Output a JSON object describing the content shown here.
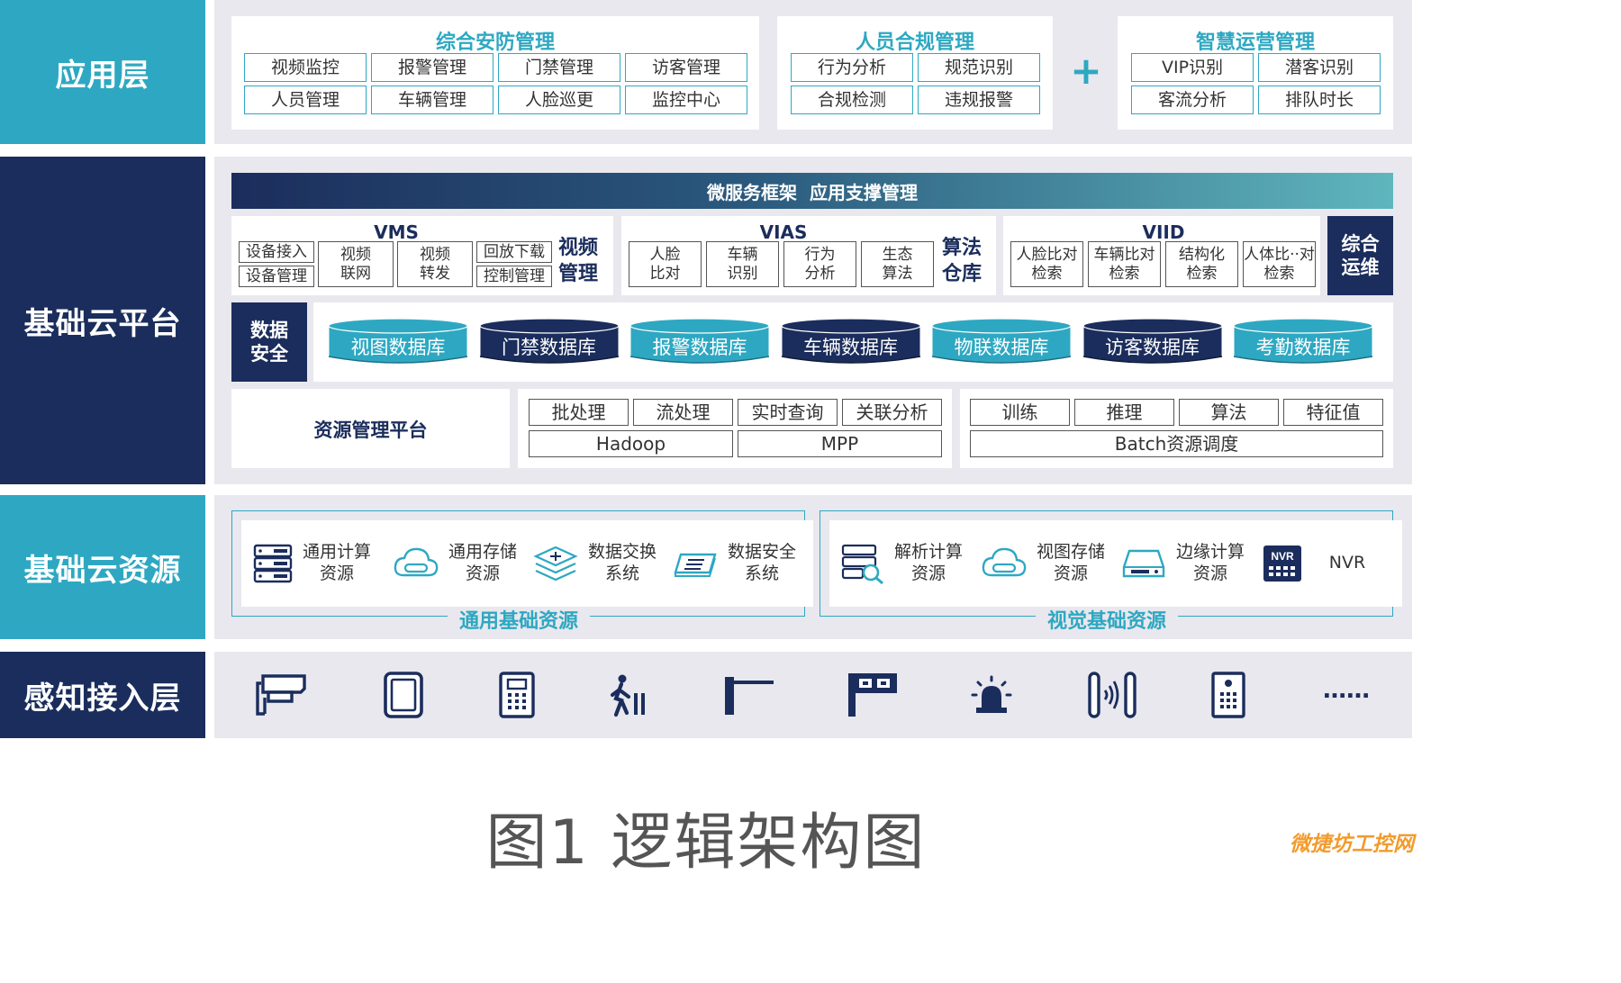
{
  "layers": {
    "app": "应用层",
    "cloud_platform": "基础云平台",
    "cloud_resource": "基础云资源",
    "perception": "感知接入层"
  },
  "app_layer": {
    "security": {
      "title": "综合安防管理",
      "items": [
        "视频监控",
        "报警管理",
        "门禁管理",
        "访客管理",
        "人员管理",
        "车辆管理",
        "人脸巡更",
        "监控中心"
      ]
    },
    "compliance": {
      "title": "人员合规管理",
      "items": [
        "行为分析",
        "规范识别",
        "合规检测",
        "违规报警"
      ]
    },
    "plus": "+",
    "operation": {
      "title": "智慧运营管理",
      "items": [
        "VIP识别",
        "潜客识别",
        "客流分析",
        "排队时长"
      ]
    }
  },
  "platform": {
    "banner": "微服务框架  应用支撑管理",
    "vms": {
      "title": "VMS",
      "access": "设备接入",
      "manage": "设备管理",
      "network": "视频\n联网",
      "forward": "视频\n转发",
      "playback": "回放下载",
      "control": "控制管理",
      "side": "视频\n管理"
    },
    "vias": {
      "title": "VIAS",
      "items": [
        "人脸\n比对",
        "车辆\n识别",
        "行为\n分析",
        "生态\n算法"
      ],
      "side": "算法\n仓库"
    },
    "viid": {
      "title": "VIID",
      "items": [
        "人脸比对\n检索",
        "车辆比对\n检索",
        "结构化\n检索",
        "人体比··对\n检索"
      ]
    },
    "ops": "综合\n运维",
    "data_security": "数据\n安全",
    "databases": [
      "视图数据库",
      "门禁数据库",
      "报警数据库",
      "车辆数据库",
      "物联数据库",
      "访客数据库",
      "考勤数据库"
    ],
    "resource_platform": "资源管理平台",
    "processing": [
      "批处理",
      "流处理",
      "实时查询",
      "关联分析"
    ],
    "hadoop": "Hadoop",
    "mpp": "MPP",
    "ml": [
      "训练",
      "推理",
      "算法",
      "特征值"
    ],
    "batch": "Batch资源调度"
  },
  "resources": {
    "general": {
      "title": "通用基础资源",
      "items": [
        {
          "label": "通用计算\n资源",
          "icon": "server-rack-icon"
        },
        {
          "label": "通用存储\n资源",
          "icon": "cloud-storage-icon"
        },
        {
          "label": "数据交换\n系统",
          "icon": "data-exchange-icon"
        },
        {
          "label": "数据安全\n系统",
          "icon": "security-appliance-icon"
        }
      ]
    },
    "visual": {
      "title": "视觉基础资源",
      "items": [
        {
          "label": "解析计算\n资源",
          "icon": "analysis-server-icon"
        },
        {
          "label": "视图存储\n资源",
          "icon": "cloud-storage-icon"
        },
        {
          "label": "边缘计算\n资源",
          "icon": "edge-disk-icon"
        },
        {
          "label": "NVR",
          "icon": "nvr-icon"
        }
      ]
    }
  },
  "perception_icons": [
    "camera-icon",
    "tablet-icon",
    "intercom-icon",
    "pedestrian-gate-icon",
    "barrier-gate-icon",
    "parking-guidance-icon",
    "alarm-light-icon",
    "access-reader-icon",
    "keypad-panel-icon"
  ],
  "perception_more": "……",
  "caption": "图1 逻辑架构图",
  "watermark": "微捷坊工控网",
  "colors": {
    "teal": "#2ea8c2",
    "navy": "#1b2d5c",
    "band": "#e8e8ee"
  }
}
